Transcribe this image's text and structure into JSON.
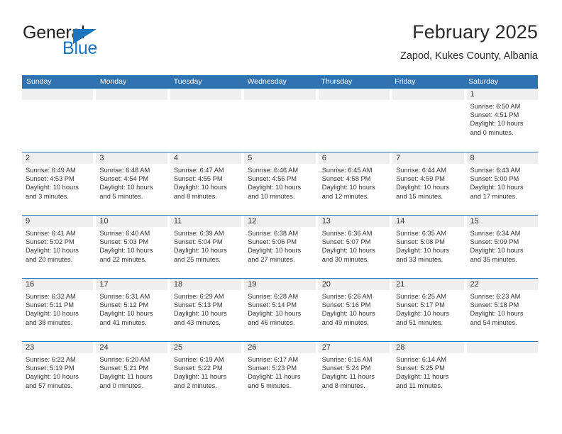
{
  "brand": {
    "general": "General",
    "blue": "Blue",
    "triangle_color": "#1b75bc"
  },
  "header": {
    "title": "February 2025",
    "subtitle": "Zapod, Kukes County, Albania"
  },
  "theme": {
    "header_blue": "#3071b0",
    "row_divider_blue": "#3071b0",
    "day_band_gray": "#efefef",
    "text": "#333333"
  },
  "weekdays": [
    "Sunday",
    "Monday",
    "Tuesday",
    "Wednesday",
    "Thursday",
    "Friday",
    "Saturday"
  ],
  "weeks": [
    [
      {
        "day": "",
        "empty": true
      },
      {
        "day": "",
        "empty": true
      },
      {
        "day": "",
        "empty": true
      },
      {
        "day": "",
        "empty": true
      },
      {
        "day": "",
        "empty": true
      },
      {
        "day": "",
        "empty": true
      },
      {
        "day": "1",
        "sunrise": "Sunrise: 6:50 AM",
        "sunset": "Sunset: 4:51 PM",
        "daylight1": "Daylight: 10 hours",
        "daylight2": "and 0 minutes."
      }
    ],
    [
      {
        "day": "2",
        "sunrise": "Sunrise: 6:49 AM",
        "sunset": "Sunset: 4:53 PM",
        "daylight1": "Daylight: 10 hours",
        "daylight2": "and 3 minutes."
      },
      {
        "day": "3",
        "sunrise": "Sunrise: 6:48 AM",
        "sunset": "Sunset: 4:54 PM",
        "daylight1": "Daylight: 10 hours",
        "daylight2": "and 5 minutes."
      },
      {
        "day": "4",
        "sunrise": "Sunrise: 6:47 AM",
        "sunset": "Sunset: 4:55 PM",
        "daylight1": "Daylight: 10 hours",
        "daylight2": "and 8 minutes."
      },
      {
        "day": "5",
        "sunrise": "Sunrise: 6:46 AM",
        "sunset": "Sunset: 4:56 PM",
        "daylight1": "Daylight: 10 hours",
        "daylight2": "and 10 minutes."
      },
      {
        "day": "6",
        "sunrise": "Sunrise: 6:45 AM",
        "sunset": "Sunset: 4:58 PM",
        "daylight1": "Daylight: 10 hours",
        "daylight2": "and 12 minutes."
      },
      {
        "day": "7",
        "sunrise": "Sunrise: 6:44 AM",
        "sunset": "Sunset: 4:59 PM",
        "daylight1": "Daylight: 10 hours",
        "daylight2": "and 15 minutes."
      },
      {
        "day": "8",
        "sunrise": "Sunrise: 6:43 AM",
        "sunset": "Sunset: 5:00 PM",
        "daylight1": "Daylight: 10 hours",
        "daylight2": "and 17 minutes."
      }
    ],
    [
      {
        "day": "9",
        "sunrise": "Sunrise: 6:41 AM",
        "sunset": "Sunset: 5:02 PM",
        "daylight1": "Daylight: 10 hours",
        "daylight2": "and 20 minutes."
      },
      {
        "day": "10",
        "sunrise": "Sunrise: 6:40 AM",
        "sunset": "Sunset: 5:03 PM",
        "daylight1": "Daylight: 10 hours",
        "daylight2": "and 22 minutes."
      },
      {
        "day": "11",
        "sunrise": "Sunrise: 6:39 AM",
        "sunset": "Sunset: 5:04 PM",
        "daylight1": "Daylight: 10 hours",
        "daylight2": "and 25 minutes."
      },
      {
        "day": "12",
        "sunrise": "Sunrise: 6:38 AM",
        "sunset": "Sunset: 5:06 PM",
        "daylight1": "Daylight: 10 hours",
        "daylight2": "and 27 minutes."
      },
      {
        "day": "13",
        "sunrise": "Sunrise: 6:36 AM",
        "sunset": "Sunset: 5:07 PM",
        "daylight1": "Daylight: 10 hours",
        "daylight2": "and 30 minutes."
      },
      {
        "day": "14",
        "sunrise": "Sunrise: 6:35 AM",
        "sunset": "Sunset: 5:08 PM",
        "daylight1": "Daylight: 10 hours",
        "daylight2": "and 33 minutes."
      },
      {
        "day": "15",
        "sunrise": "Sunrise: 6:34 AM",
        "sunset": "Sunset: 5:09 PM",
        "daylight1": "Daylight: 10 hours",
        "daylight2": "and 35 minutes."
      }
    ],
    [
      {
        "day": "16",
        "sunrise": "Sunrise: 6:32 AM",
        "sunset": "Sunset: 5:11 PM",
        "daylight1": "Daylight: 10 hours",
        "daylight2": "and 38 minutes."
      },
      {
        "day": "17",
        "sunrise": "Sunrise: 6:31 AM",
        "sunset": "Sunset: 5:12 PM",
        "daylight1": "Daylight: 10 hours",
        "daylight2": "and 41 minutes."
      },
      {
        "day": "18",
        "sunrise": "Sunrise: 6:29 AM",
        "sunset": "Sunset: 5:13 PM",
        "daylight1": "Daylight: 10 hours",
        "daylight2": "and 43 minutes."
      },
      {
        "day": "19",
        "sunrise": "Sunrise: 6:28 AM",
        "sunset": "Sunset: 5:14 PM",
        "daylight1": "Daylight: 10 hours",
        "daylight2": "and 46 minutes."
      },
      {
        "day": "20",
        "sunrise": "Sunrise: 6:26 AM",
        "sunset": "Sunset: 5:16 PM",
        "daylight1": "Daylight: 10 hours",
        "daylight2": "and 49 minutes."
      },
      {
        "day": "21",
        "sunrise": "Sunrise: 6:25 AM",
        "sunset": "Sunset: 5:17 PM",
        "daylight1": "Daylight: 10 hours",
        "daylight2": "and 51 minutes."
      },
      {
        "day": "22",
        "sunrise": "Sunrise: 6:23 AM",
        "sunset": "Sunset: 5:18 PM",
        "daylight1": "Daylight: 10 hours",
        "daylight2": "and 54 minutes."
      }
    ],
    [
      {
        "day": "23",
        "sunrise": "Sunrise: 6:22 AM",
        "sunset": "Sunset: 5:19 PM",
        "daylight1": "Daylight: 10 hours",
        "daylight2": "and 57 minutes."
      },
      {
        "day": "24",
        "sunrise": "Sunrise: 6:20 AM",
        "sunset": "Sunset: 5:21 PM",
        "daylight1": "Daylight: 11 hours",
        "daylight2": "and 0 minutes."
      },
      {
        "day": "25",
        "sunrise": "Sunrise: 6:19 AM",
        "sunset": "Sunset: 5:22 PM",
        "daylight1": "Daylight: 11 hours",
        "daylight2": "and 2 minutes."
      },
      {
        "day": "26",
        "sunrise": "Sunrise: 6:17 AM",
        "sunset": "Sunset: 5:23 PM",
        "daylight1": "Daylight: 11 hours",
        "daylight2": "and 5 minutes."
      },
      {
        "day": "27",
        "sunrise": "Sunrise: 6:16 AM",
        "sunset": "Sunset: 5:24 PM",
        "daylight1": "Daylight: 11 hours",
        "daylight2": "and 8 minutes."
      },
      {
        "day": "28",
        "sunrise": "Sunrise: 6:14 AM",
        "sunset": "Sunset: 5:25 PM",
        "daylight1": "Daylight: 11 hours",
        "daylight2": "and 11 minutes."
      },
      {
        "day": "",
        "empty": true
      }
    ]
  ]
}
